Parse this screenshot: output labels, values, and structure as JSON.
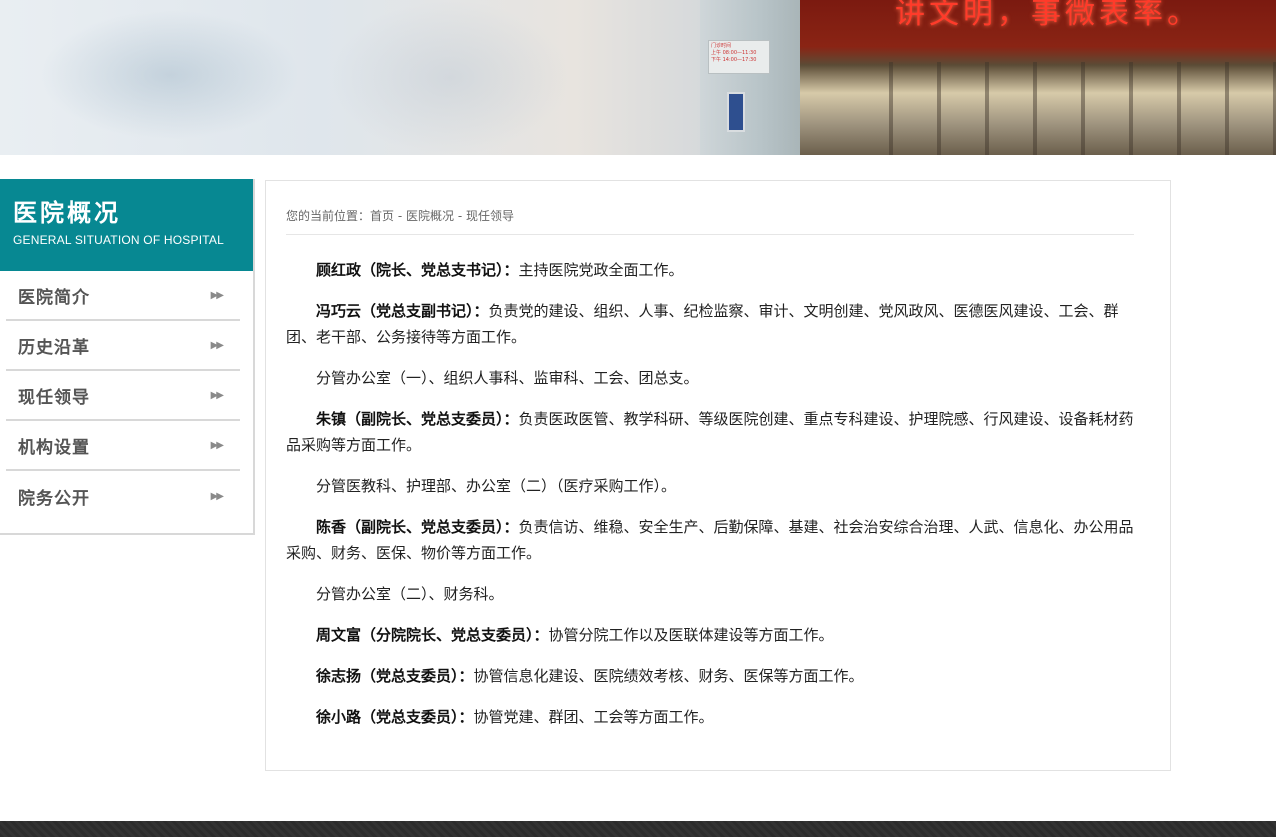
{
  "banner": {
    "led_text": "讲文明，事微表率。",
    "sign_lines": [
      "门诊时间",
      "上午 08:00—11:30",
      "下午 14:00—17:30"
    ]
  },
  "sidebar": {
    "title": "医院概况",
    "subtitle": "GENERAL SITUATION OF HOSPITAL",
    "items": [
      {
        "label": "医院简介"
      },
      {
        "label": "历史沿革"
      },
      {
        "label": "现任领导"
      },
      {
        "label": "机构设置"
      },
      {
        "label": "院务公开"
      }
    ]
  },
  "breadcrumb": {
    "prefix": "您的当前位置：",
    "home": "首页",
    "sep": " - ",
    "section": "医院概况",
    "current": "现任领导"
  },
  "article": {
    "paragraphs": [
      {
        "name": "顾红政（院长、党总支书记）",
        "colon": "：",
        "text": "主持医院党政全面工作。"
      },
      {
        "name": "冯巧云（党总支副书记）",
        "colon": "：",
        "text": "负责党的建设、组织、人事、纪检监察、审计、文明创建、党风政风、医德医风建设、工会、群团、老干部、公务接待等方面工作。"
      },
      {
        "name": "",
        "colon": "",
        "text": "分管办公室（一）、组织人事科、监审科、工会、团总支。"
      },
      {
        "name": "朱镇（副院长、党总支委员）",
        "colon": "：",
        "text": "负责医政医管、教学科研、等级医院创建、重点专科建设、护理院感、行风建设、设备耗材药品采购等方面工作。"
      },
      {
        "name": "",
        "colon": "",
        "text": "分管医教科、护理部、办公室（二）（医疗采购工作）。"
      },
      {
        "name": "陈香（副院长、党总支委员）",
        "colon": "：",
        "text": "负责信访、维稳、安全生产、后勤保障、基建、社会治安综合治理、人武、信息化、办公用品采购、财务、医保、物价等方面工作。"
      },
      {
        "name": "",
        "colon": "",
        "text": "分管办公室（二）、财务科。"
      },
      {
        "name": "周文富（分院院长、党总支委员）",
        "colon": "：",
        "text": "协管分院工作以及医联体建设等方面工作。"
      },
      {
        "name": "徐志扬（党总支委员）",
        "colon": "：",
        "text": "协管信息化建设、医院绩效考核、财务、医保等方面工作。"
      },
      {
        "name": "徐小路（党总支委员）",
        "colon": "：",
        "text": "协管党建、群团、工会等方面工作。"
      }
    ]
  },
  "colors": {
    "sidebar_header": "#078892",
    "footer": "#2c2c2c"
  }
}
